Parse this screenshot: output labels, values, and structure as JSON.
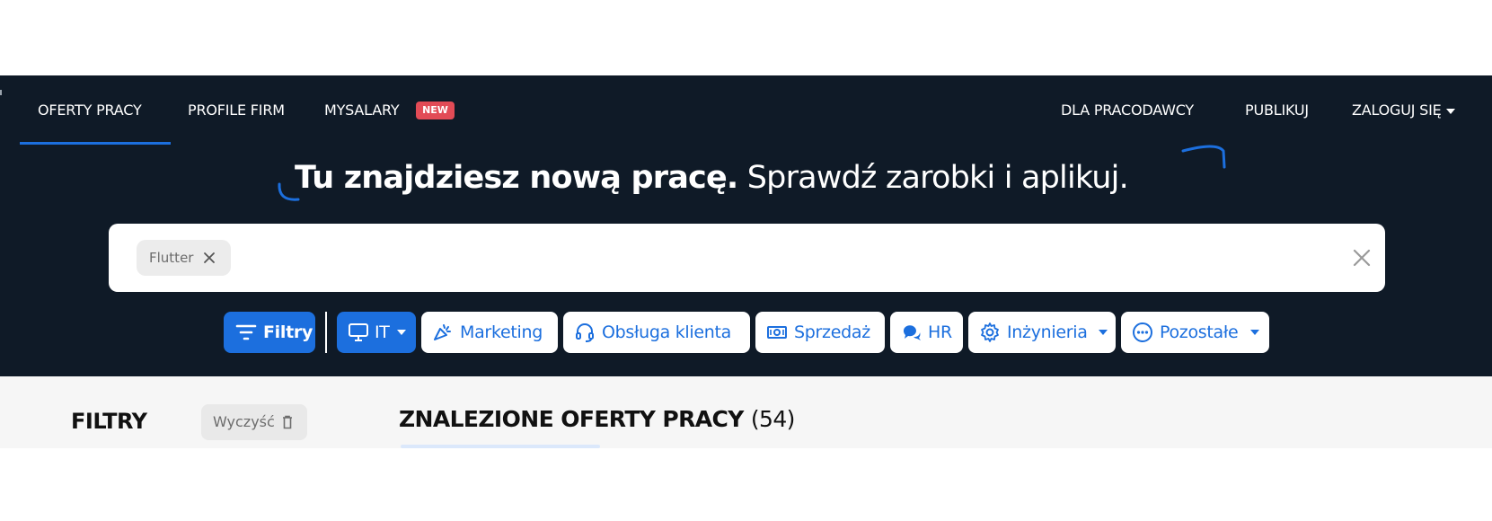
{
  "nav": {
    "left": [
      {
        "label": "OFERTY PRACY"
      },
      {
        "label": "PROFILE FIRM"
      },
      {
        "label": "MYSALARY"
      }
    ],
    "new_badge": "NEW",
    "right": [
      {
        "label": "DLA PRACODAWCY"
      },
      {
        "label": "PUBLIKUJ"
      },
      {
        "label": "ZALOGUJ SIĘ"
      }
    ]
  },
  "headline": {
    "bold": "Tu znajdziesz nową pracę.",
    "light": "Sprawdź zarobki i aplikuj."
  },
  "search": {
    "chip": "Flutter"
  },
  "categories": {
    "filters": "Filtry",
    "it": "IT",
    "marketing": "Marketing",
    "customer_service": "Obsługa klienta",
    "sales": "Sprzedaż",
    "hr": "HR",
    "engineering": "Inżynieria",
    "other": "Pozostałe"
  },
  "sidebar": {
    "title": "FILTRY",
    "clear": "Wyczyść"
  },
  "results": {
    "title": "ZNALEZIONE OFERTY PRACY",
    "count": "(54)"
  },
  "colors": {
    "header_bg": "#0f1a27",
    "accent": "#1c6fde",
    "badge": "#e24b56"
  }
}
